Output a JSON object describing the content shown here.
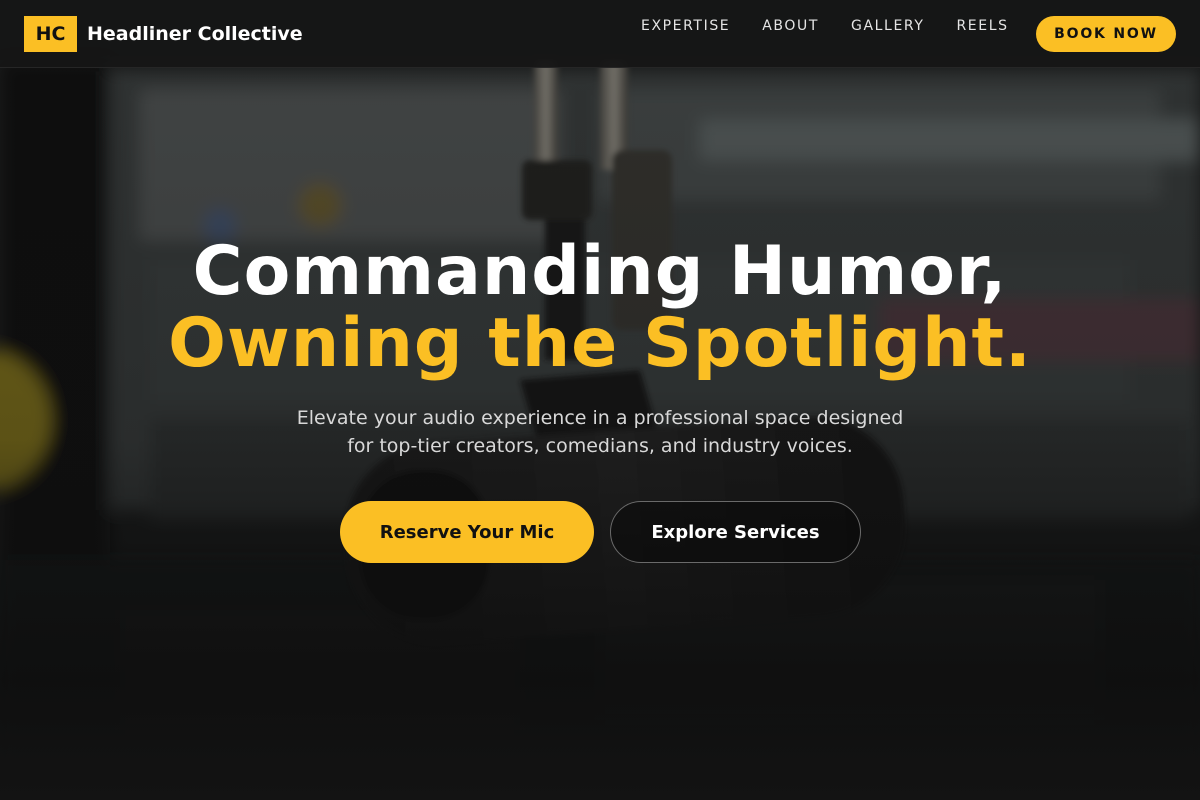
{
  "brand": {
    "mark": "HC",
    "name": "Headliner Collective"
  },
  "nav": {
    "items": [
      {
        "label": "EXPERTISE"
      },
      {
        "label": "ABOUT"
      },
      {
        "label": "GALLERY"
      },
      {
        "label": "REELS"
      }
    ],
    "cta_label": "BOOK NOW"
  },
  "hero": {
    "title_line1": "Commanding Humor,",
    "title_line2": "Owning the Spotlight.",
    "subtitle_line1": "Elevate your audio experience in a professional space designed",
    "subtitle_line2": "for top-tier creators, comedians, and industry voices.",
    "primary_cta": "Reserve Your Mic",
    "secondary_cta": "Explore Services",
    "background_image": "studio-microphone-photo"
  },
  "colors": {
    "accent": "#fbbf24",
    "header_bg": "#161616",
    "text_primary": "#ffffff",
    "text_secondary": "#d8d8d8"
  }
}
